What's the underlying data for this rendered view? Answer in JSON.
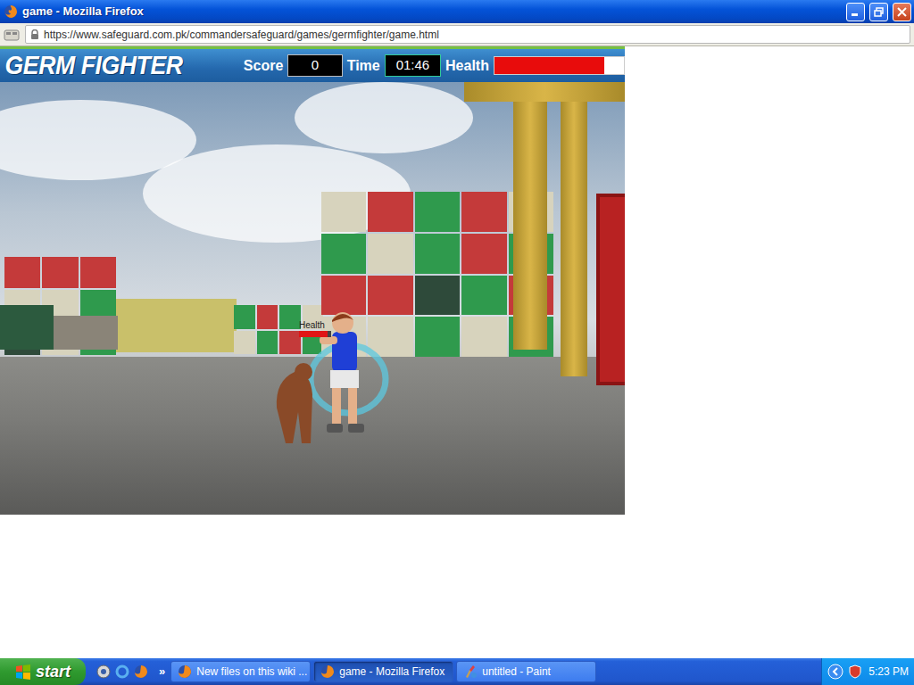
{
  "window": {
    "title": "game - Mozilla Firefox"
  },
  "address_bar": {
    "url": "https://www.safeguard.com.pk/commandersafeguard/games/germfighter/game.html",
    "secure": true
  },
  "game": {
    "title": "GERM FIGHTER",
    "score": {
      "label": "Score",
      "value": "0"
    },
    "time": {
      "label": "Time",
      "value": "01:46"
    },
    "health": {
      "label": "Health",
      "level": 0.85
    },
    "enemy_health": {
      "label": "Health",
      "level": 0.9
    }
  },
  "taskbar": {
    "start": "start",
    "overflow": "»",
    "tasks": [
      {
        "label": "New files on this wiki ...",
        "selected": false,
        "kind": "browser"
      },
      {
        "label": "game - Mozilla Firefox",
        "selected": true,
        "kind": "browser"
      },
      {
        "label": "untitled - Paint",
        "selected": false,
        "kind": "paint"
      }
    ],
    "clock": "5:23 PM"
  }
}
